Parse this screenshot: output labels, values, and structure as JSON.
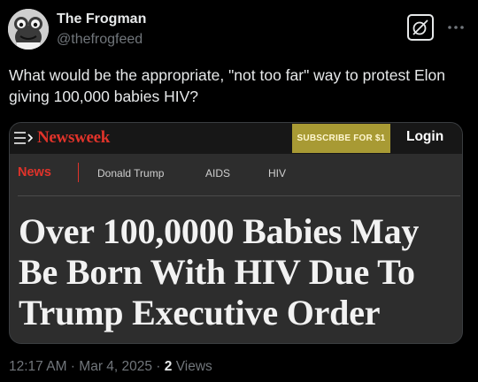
{
  "author": {
    "display_name": "The Frogman",
    "handle": "@thefrogfeed"
  },
  "header_icons": {
    "grok": "grok-icon",
    "more": "more-horizontal-icon"
  },
  "tweet": {
    "text": "What would be the appropriate, \"not too far\" way to protest Elon giving 100,000 babies HIV?"
  },
  "card": {
    "logo": "Newsweek",
    "subscribe_label": "SUBSCRIBE FOR $1",
    "login_label": "Login",
    "nav": {
      "section": "News",
      "items": [
        "Donald Trump",
        "AIDS",
        "HIV"
      ]
    },
    "headline": "Over 100,0000 Babies May Be Born With HIV Due To Trump Executive Order",
    "colors": {
      "brand_red": "#e0332a",
      "subscribe_bg": "#a89a34"
    }
  },
  "meta": {
    "time": "12:17 AM",
    "separator1": " · ",
    "date": "Mar 4, 2025",
    "separator2": " · ",
    "views_count": "2",
    "views_label": " Views"
  }
}
